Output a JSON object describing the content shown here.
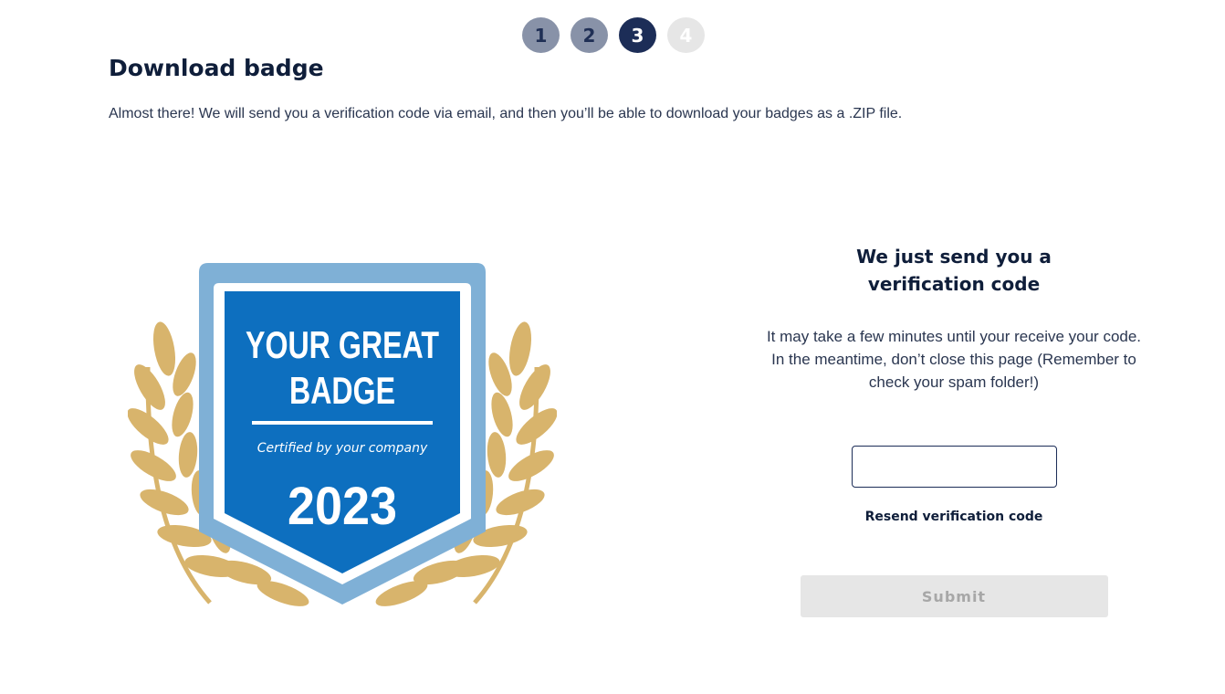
{
  "stepper": {
    "steps": [
      {
        "label": "1",
        "state": "done"
      },
      {
        "label": "2",
        "state": "done"
      },
      {
        "label": "3",
        "state": "active"
      },
      {
        "label": "4",
        "state": "todo"
      }
    ]
  },
  "page": {
    "title": "Download badge",
    "intro": "Almost there! We will send you a verification code via email, and then you’ll be able to download your badges as a .ZIP file."
  },
  "badge": {
    "line1": "YOUR GREAT",
    "line2": "BADGE",
    "subtitle": "Certified by your company",
    "year": "2023"
  },
  "verification": {
    "heading": "We just send you a verification code",
    "description": "It may take a few minutes until your receive your code. In the meantime, don’t close this page (Remember to check your spam folder!)",
    "code_value": "",
    "resend_label": "Resend verification code",
    "submit_label": "Submit"
  },
  "colors": {
    "primary": "#1c2d57",
    "badge_blue": "#0d6fbf",
    "badge_frame": "#7fb0d6",
    "laurel": "#d8b46c",
    "disabled": "#e6e6e6"
  }
}
